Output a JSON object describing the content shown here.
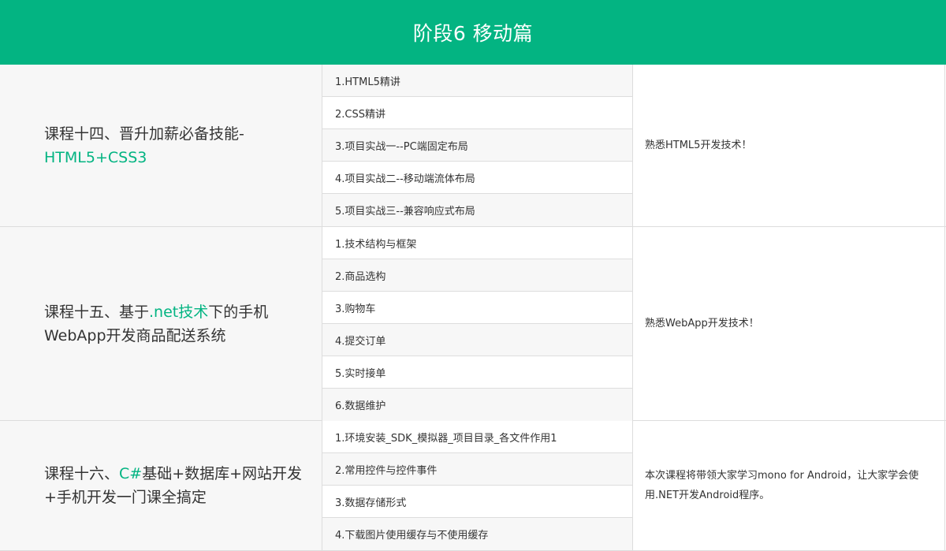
{
  "header": {
    "title": "阶段6 移动篇"
  },
  "courses": [
    {
      "name_plain": "课程十四、晋升加薪必备技能-",
      "name_green": "HTML5+CSS3",
      "lessons": [
        "1.HTML5精讲",
        "2.CSS精讲",
        "3.项目实战一--PC端固定布局",
        "4.项目实战二--移动端流体布局",
        "5.项目实战三--兼容响应式布局"
      ],
      "desc": "熟悉HTML5开发技术！"
    },
    {
      "name_pre": "课程十五、基于",
      "name_green": ".net技术",
      "name_post": "下的手机WebApp开发商品配送系统",
      "lessons": [
        "1.技术结构与框架",
        "2.商品选构",
        "3.购物车",
        "4.提交订单",
        "5.实时接单",
        "6.数据维护"
      ],
      "desc": "熟悉WebApp开发技术！"
    },
    {
      "name_pre": "课程十六、",
      "name_green": "C#",
      "name_post": "基础+数据库+网站开发+手机开发一门课全搞定",
      "lessons": [
        "1.环境安装_SDK_模拟器_项目目录_各文件作用1",
        "2.常用控件与控件事件",
        "3.数据存储形式",
        "4.下载图片使用缓存与不使用缓存"
      ],
      "desc": "本次课程将带领大家学习mono for Android，让大家学会使用.NET开发Android程序。"
    }
  ],
  "colors": {
    "accent": "#03b482",
    "row_alt": "#f7f7f7",
    "border": "#dddddd",
    "text": "#333333"
  }
}
